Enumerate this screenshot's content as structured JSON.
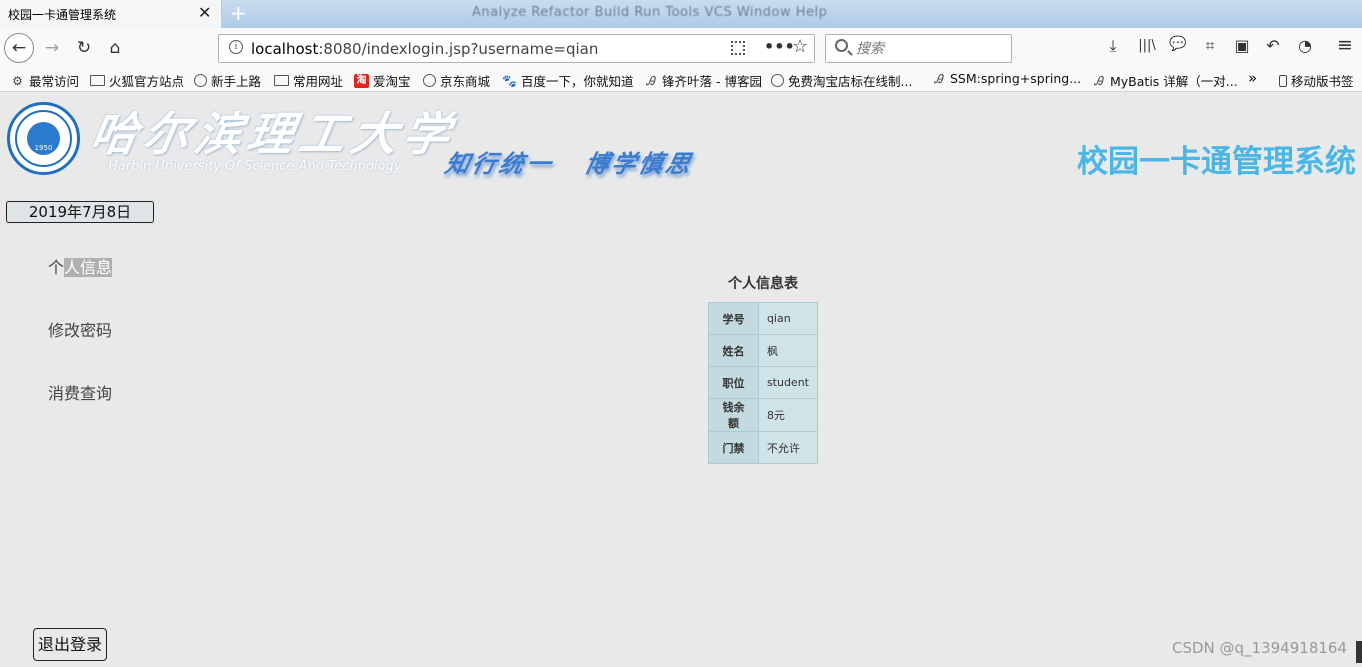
{
  "browser": {
    "tab_title": "校园一卡通管理系统",
    "tab_close": "✕",
    "new_tab": "+",
    "ide_menu": "Analyze  Refactor  Build  Run  Tools  VCS  Window  Help",
    "url_host": "localhost",
    "url_rest": ":8080/indexlogin.jsp?username=qian",
    "search_placeholder": "搜索",
    "icons": {
      "back": "←",
      "forward": "→",
      "reload": "↻",
      "home": "⌂",
      "more": "•••",
      "star": "☆",
      "download": "⤓",
      "library": "|||\\",
      "chat": "💬",
      "crop": "⌗",
      "reader": "▣",
      "undo": "↶",
      "account": "◔",
      "menu": "≡"
    }
  },
  "bookmarks": [
    {
      "label": "最常访问",
      "icon": "gear-icon",
      "glyph": "⚙"
    },
    {
      "label": "火狐官方站点",
      "icon": "folder-icon",
      "glyph": ""
    },
    {
      "label": "新手上路",
      "icon": "globe-icon",
      "glyph": ""
    },
    {
      "label": "常用网址",
      "icon": "folder-icon",
      "glyph": ""
    },
    {
      "label": "爱淘宝",
      "icon": "taobao-icon",
      "glyph": "淘"
    },
    {
      "label": "京东商城",
      "icon": "globe-icon",
      "glyph": ""
    },
    {
      "label": "百度一下，你就知道",
      "icon": "baidu-icon",
      "glyph": "🐾"
    },
    {
      "label": "锋齐叶落 - 博客园",
      "icon": "blog-icon",
      "glyph": "Ꭿ"
    },
    {
      "label": "免费淘宝店标在线制...",
      "icon": "globe-icon",
      "glyph": ""
    },
    {
      "label": "SSM:spring+spring...",
      "icon": "blog-icon",
      "glyph": "Ꭿ"
    },
    {
      "label": "MyBatis 详解（一对...",
      "icon": "blog-icon",
      "glyph": "Ꭿ"
    }
  ],
  "bookmarks_overflow": "»",
  "mobile_bookmarks": "移动版书签",
  "header": {
    "university_cn": "哈尔滨理工大学",
    "university_en": "Harbin University Of Science And Technology",
    "emblem_year": "1950",
    "motto": "知行统一 博学慎思",
    "system_title": "校园一卡通管理系统"
  },
  "date": "2019年7月8日",
  "sidebar": {
    "items": [
      {
        "prefix": "个",
        "highlight": "人信息"
      },
      {
        "label": "修改密码"
      },
      {
        "label": "消费查询"
      }
    ]
  },
  "profile": {
    "caption": "个人信息表",
    "rows": [
      {
        "key": "学号",
        "value": "qian"
      },
      {
        "key": "姓名",
        "value": "枫"
      },
      {
        "key": "职位",
        "value": "student"
      },
      {
        "key": "钱余额",
        "value": "8元"
      },
      {
        "key": "门禁",
        "value": "不允许"
      }
    ]
  },
  "logout_label": "退出登录",
  "watermark": "CSDN @q_1394918164"
}
